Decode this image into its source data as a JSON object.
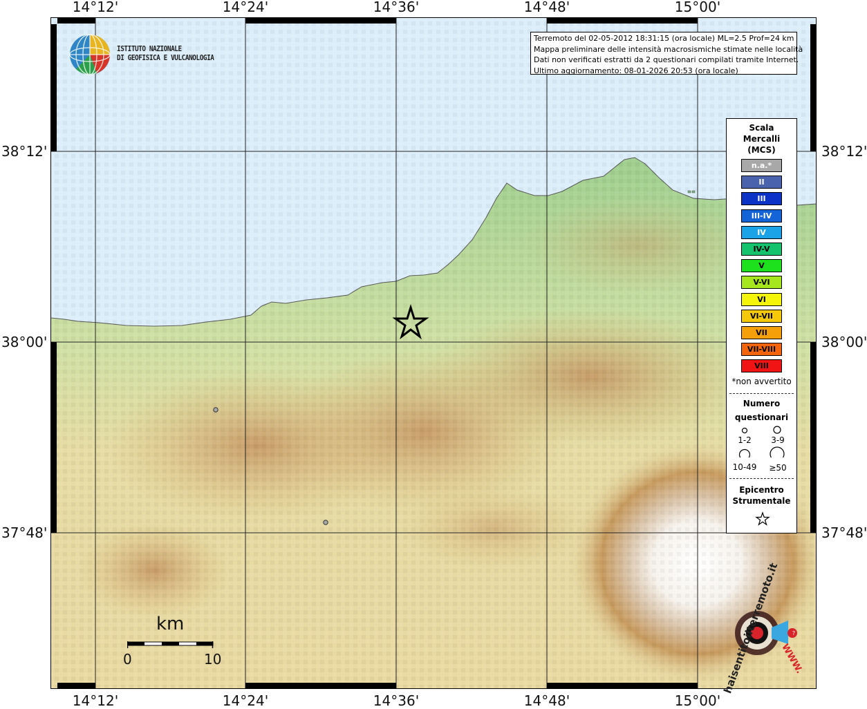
{
  "axes": {
    "top_labels": [
      "14°12'",
      "14°24'",
      "14°36'",
      "14°48'",
      "15°00'"
    ],
    "bottom_labels": [
      "14°12'",
      "14°24'",
      "14°36'",
      "14°48'",
      "15°00'"
    ],
    "left_labels": [
      "38°12'",
      "38°00'",
      "37°48'"
    ],
    "right_labels": [
      "38°12'",
      "38°00'",
      "37°48'"
    ]
  },
  "info": {
    "line1": "Terremoto del 02-05-2012 18:31:15 (ora locale) ML=2.5 Prof=24 km",
    "line2": "Mappa preliminare delle intensità macrosismiche stimate nelle località",
    "line3": "Dati non verificati estratti da 2 questionari compilati tramite Internet.",
    "line4": "Ultimo aggiornamento: 08-01-2026 20:53 (ora locale)"
  },
  "ingv": {
    "line1": "ISTITUTO NAZIONALE",
    "line2": "DI GEOFISICA E VULCANOLOGIA"
  },
  "legend": {
    "title1": "Scala",
    "title2": "Mercalli",
    "title3": "(MCS)",
    "mcs_items": [
      {
        "label": "n.a.*",
        "color": "#a8a8a8",
        "text_color": "#ffffff"
      },
      {
        "label": "II",
        "color": "#4a63ad",
        "text_color": "#ffffff"
      },
      {
        "label": "III",
        "color": "#0b33c5",
        "text_color": "#ffffff"
      },
      {
        "label": "III-IV",
        "color": "#1464d8",
        "text_color": "#ffffff"
      },
      {
        "label": "IV",
        "color": "#1aa3e6",
        "text_color": "#ffffff"
      },
      {
        "label": "IV-V",
        "color": "#14c36b",
        "text_color": "#000000"
      },
      {
        "label": "V",
        "color": "#1ee11e",
        "text_color": "#000000"
      },
      {
        "label": "V-VI",
        "color": "#a5e61e",
        "text_color": "#000000"
      },
      {
        "label": "VI",
        "color": "#f5f50a",
        "text_color": "#000000"
      },
      {
        "label": "VI-VII",
        "color": "#f5c80a",
        "text_color": "#000000"
      },
      {
        "label": "VII",
        "color": "#f5a00a",
        "text_color": "#000000"
      },
      {
        "label": "VII-VIII",
        "color": "#f5640a",
        "text_color": "#000000"
      },
      {
        "label": "VIII",
        "color": "#f01414",
        "text_color": "#000000"
      }
    ],
    "not_felt_note": "*non avvertito",
    "questionnaires_title1": "Numero",
    "questionnaires_title2": "questionari",
    "q_labels": [
      "1-2",
      "3-9",
      "10-49",
      "≥50"
    ],
    "epicenter_title1": "Epicentro",
    "epicenter_title2": "Strumentale"
  },
  "scalebar": {
    "unit": "km",
    "min": "0",
    "max": "10"
  },
  "colors": {
    "sea": "#dceefa",
    "frame": "#000000",
    "grid": "#222222"
  },
  "watermark": {
    "text": "haisentitoilterremoto.it",
    "url": "WWW."
  }
}
